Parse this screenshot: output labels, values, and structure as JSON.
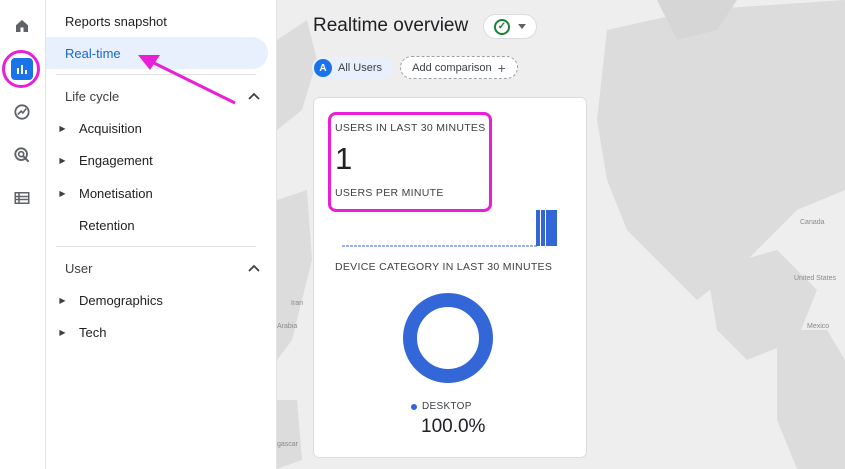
{
  "rail": {
    "items": [
      {
        "name": "home-icon"
      },
      {
        "name": "reports-icon",
        "active": true
      },
      {
        "name": "explore-icon"
      },
      {
        "name": "advertising-icon"
      },
      {
        "name": "configure-icon"
      }
    ]
  },
  "nav": {
    "reports_snapshot": "Reports snapshot",
    "realtime": "Real-time",
    "lifecycle": {
      "title": "Life cycle",
      "items": [
        "Acquisition",
        "Engagement",
        "Monetisation",
        "Retention"
      ]
    },
    "user": {
      "title": "User",
      "items": [
        "Demographics",
        "Tech"
      ]
    }
  },
  "main": {
    "title": "Realtime overview",
    "all_users": "All Users",
    "all_users_badge": "A",
    "add_comparison": "Add comparison",
    "card": {
      "users_label": "USERS IN LAST 30 MINUTES",
      "users_value": "1",
      "per_minute_label": "USERS PER MINUTE",
      "device_label": "DEVICE CATEGORY IN LAST 30 MINUTES",
      "legend_label": "DESKTOP",
      "legend_value": "100.0%"
    },
    "map_labels": [
      "Canada",
      "United States",
      "Mexico",
      "Iran",
      "Arabia",
      "gascar"
    ]
  },
  "colors": {
    "accent": "#1a73e8",
    "highlight": "#e91ed8",
    "chart": "#3366d6",
    "active_nav_bg": "#e8f0fe"
  }
}
